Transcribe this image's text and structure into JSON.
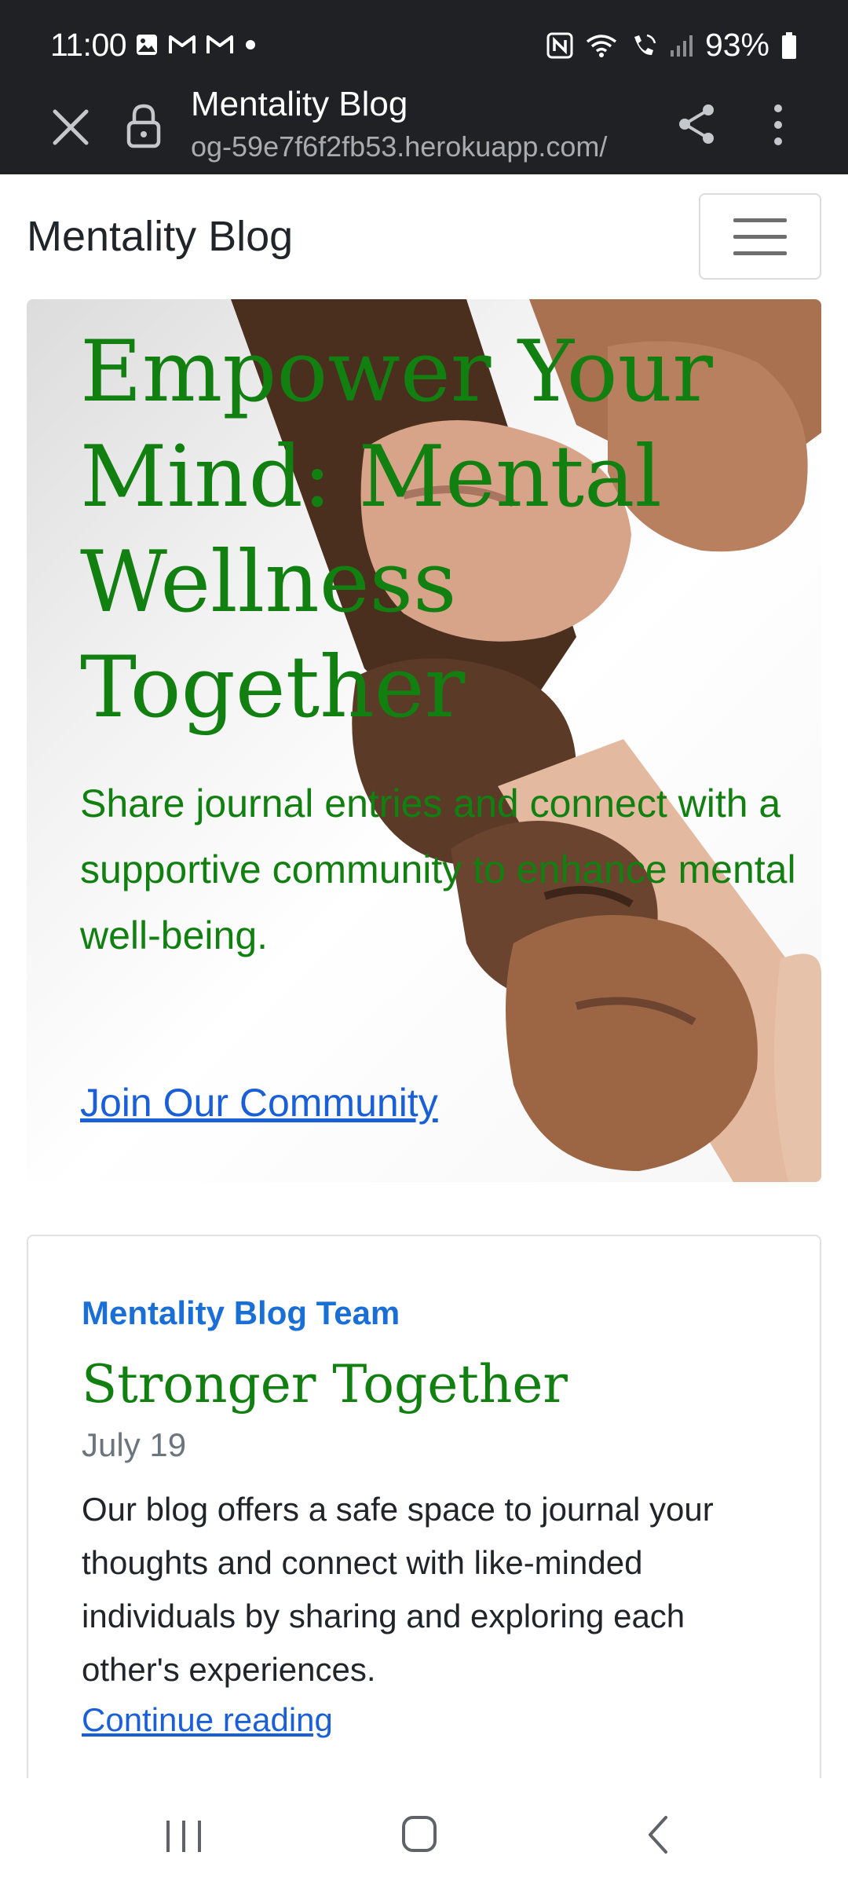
{
  "status_bar": {
    "time": "11:00",
    "battery": "93%",
    "left_icons": [
      "gallery-icon",
      "gmail-icon",
      "gmail-icon",
      "dot-icon"
    ],
    "right_icons": [
      "nfc-icon",
      "wifi-icon",
      "wifi-calling-icon",
      "signal-icon",
      "battery-icon"
    ]
  },
  "browser": {
    "title": "Mentality Blog",
    "url": "og-59e7f6f2fb53.herokuapp.com/",
    "icons": [
      "close-icon",
      "lock-icon",
      "share-icon",
      "more-vert-icon"
    ]
  },
  "site": {
    "brand": "Mentality Blog",
    "menu_icon": "hamburger-menu-icon"
  },
  "hero": {
    "title": "Empower Your Mind: Mental Wellness Together",
    "lead": "Share journal entries and connect with a supportive community to enhance mental well-being.",
    "cta": "Join Our Community"
  },
  "post": {
    "author": "Mentality Blog Team",
    "title": "Stronger Together",
    "date": "July 19",
    "excerpt": "Our blog offers a safe space to journal your thoughts and connect with like-minded individuals by sharing and exploring each other's experiences.",
    "link": "Continue reading"
  },
  "android_nav": {
    "icons": [
      "recents-icon",
      "home-icon",
      "back-icon"
    ]
  },
  "colors": {
    "accent_green": "#118011",
    "link_blue": "#1a5fd6",
    "author_blue": "#1a6fd6",
    "chrome_dark": "#1f2124"
  }
}
